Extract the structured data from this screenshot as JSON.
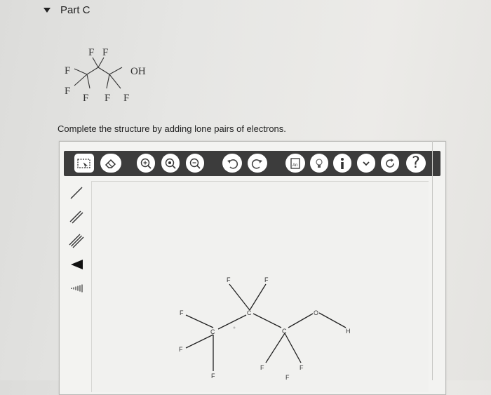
{
  "part": {
    "expand_icon": "triangle-down",
    "label": "Part C"
  },
  "question_structure": {
    "atoms": [
      "F",
      "F",
      "F",
      "OH",
      "F",
      "F",
      "F",
      "F"
    ]
  },
  "instruction": "Complete the structure by adding lone pairs of electrons.",
  "toolbar": {
    "background": "#3c3c3c",
    "icons": [
      "select-icon",
      "eraser-icon",
      "zoom-in-icon",
      "zoom-reset-icon",
      "zoom-out-icon",
      "undo-icon",
      "redo-icon",
      "template-icon",
      "lightbulb-icon",
      "info-icon",
      "chevron-down-icon",
      "reset-icon",
      "help-icon"
    ],
    "template_label": "An",
    "help_label": "?"
  },
  "sidebar": {
    "tools": [
      "single-bond-icon",
      "double-bond-icon",
      "triple-bond-icon",
      "wedge-bond-icon",
      "hash-bond-icon"
    ]
  },
  "canvas_molecule": {
    "atoms": [
      "F",
      "F",
      "F",
      "F",
      "C",
      "C",
      "C",
      "F",
      "F",
      "F",
      "F",
      "O",
      "H"
    ]
  }
}
